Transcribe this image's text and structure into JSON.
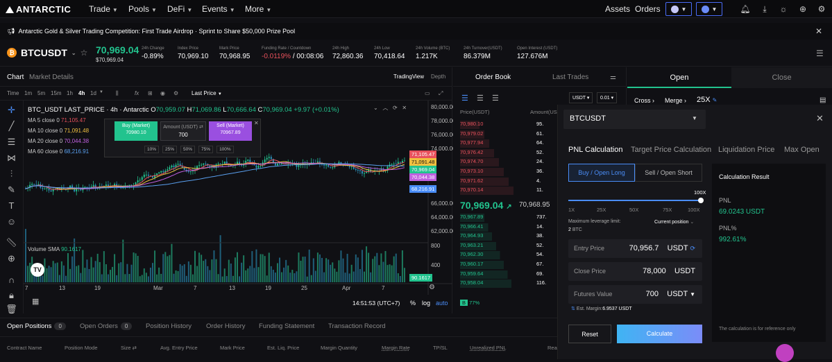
{
  "nav": {
    "logo": "ANTARCTIC",
    "items": [
      "Trade",
      "Pools",
      "DeFi",
      "Events",
      "More"
    ],
    "assets": "Assets",
    "orders": "Orders"
  },
  "banner": {
    "text": "Antarctic Gold & Silver Trading Competition: First Trade Airdrop · Sprint to Share $50,000 Prize Pool"
  },
  "ticker": {
    "symbol": "BTCUSDT",
    "price": "70,969.04",
    "sub_price": "$70,969.04",
    "stats": [
      {
        "label": "24h Change",
        "value": "-0.89%",
        "color": "red"
      },
      {
        "label": "Index Price",
        "value": "70,969.10",
        "color": "white"
      },
      {
        "label": "Mark Price",
        "value": "70,968.95",
        "color": "white"
      },
      {
        "label": "Funding Rate / Countdown",
        "value": "-0.0119%",
        "value2": "/ 00:08:06",
        "color": "red"
      },
      {
        "label": "24h High",
        "value": "72,860.36",
        "color": "white"
      },
      {
        "label": "24h Low",
        "value": "70,418.64",
        "color": "white"
      },
      {
        "label": "24h Volume (BTC)",
        "value": "1.217K",
        "color": "white"
      },
      {
        "label": "24h Turnover(USDT)",
        "value": "86.379M",
        "color": "white"
      },
      {
        "label": "Open Interest (USDT)",
        "value": "127.676M",
        "color": "white"
      }
    ]
  },
  "chart": {
    "tab_chart": "Chart",
    "tab_market": "Market Details",
    "tab_tv": "TradingView",
    "tab_depth": "Depth",
    "intervals": [
      "Time",
      "1m",
      "5m",
      "15m",
      "1h",
      "4h",
      "1d"
    ],
    "last_price": "Last Price",
    "title": "BTC_USDT LAST_PRICE · 4h · Antarctic",
    "ohlc": {
      "o": "70,959.07",
      "h": "71,069.86",
      "l": "70,666.64",
      "c": "70,969.04",
      "chg": "+9.97 (+0.01%)"
    },
    "ma": [
      {
        "label": "MA 5 close 0",
        "value": "71,105.47",
        "color": "#e8515c"
      },
      {
        "label": "MA 10 close 0",
        "value": "71,091.48",
        "color": "#f0c040"
      },
      {
        "label": "MA 20 close 0",
        "value": "70,044.38",
        "color": "#c060e0"
      },
      {
        "label": "MA 60 close 0",
        "value": "68,216.91",
        "color": "#5aa0f0"
      }
    ],
    "volume": {
      "label": "Volume",
      "sma": "SMA",
      "value": "90.1617"
    },
    "yaxis": [
      "80,000.00",
      "78,000.00",
      "76,000.00",
      "74,000.00",
      "66,000.00",
      "64,000.00",
      "62,000.00"
    ],
    "vol_axis": [
      "800",
      "400"
    ],
    "price_tags": [
      {
        "v": "71,105.47",
        "c": "#e8515c"
      },
      {
        "v": "71,091.48",
        "c": "#f0c040"
      },
      {
        "v": "70,969.04",
        "c": "#22c38e"
      },
      {
        "v": "70,044.38",
        "c": "#c060e0"
      },
      {
        "v": "68,216.91",
        "c": "#4a8df8"
      },
      {
        "v": "90.1617",
        "c": "#22c38e"
      }
    ],
    "xaxis": [
      "7",
      "13",
      "19",
      "Mar",
      "7",
      "13",
      "19",
      "25",
      "Apr",
      "7"
    ],
    "time": "14:51:53 (UTC+7)",
    "pct": "%",
    "log": "log",
    "auto": "auto",
    "quick": {
      "buy": "Buy (Market)",
      "buy_price": "70980.10",
      "amount_label": "Amount (USDT)",
      "amount": "700",
      "sell": "Sell (Market)",
      "sell_price": "70967.89",
      "pcts": [
        "10%",
        "25%",
        "50%",
        "75%",
        "100%"
      ]
    }
  },
  "orderbook": {
    "tab_ob": "Order Book",
    "tab_lt": "Last Trades",
    "unit": "USDT",
    "step": "0.01",
    "col_price": "Price(USDT)",
    "col_amount": "Amount(USDT)",
    "asks": [
      [
        "70,980.10",
        "95."
      ],
      [
        "70,979.02",
        "61."
      ],
      [
        "70,977.94",
        "64."
      ],
      [
        "70,976.42",
        "52."
      ],
      [
        "70,974.70",
        "24."
      ],
      [
        "70,973.10",
        "36."
      ],
      [
        "70,971.62",
        "4."
      ],
      [
        "70,970.14",
        "11."
      ]
    ],
    "mid": "70,969.04",
    "mid_mark": "70,968.95",
    "bids": [
      [
        "70,967.89",
        "737."
      ],
      [
        "70,966.41",
        "14."
      ],
      [
        "70,964.93",
        "38."
      ],
      [
        "70,963.21",
        "52."
      ],
      [
        "70,962.30",
        "54."
      ],
      [
        "70,960.17",
        "67."
      ],
      [
        "70,959.64",
        "69."
      ],
      [
        "70,958.04",
        "116."
      ]
    ],
    "ratio": "77%"
  },
  "trade": {
    "open": "Open",
    "close": "Close",
    "cross": "Cross",
    "merge": "Merge",
    "leverage": "25X"
  },
  "calc": {
    "symbol": "BTCUSDT",
    "tabs": [
      "PNL Calculation",
      "Target Price Calculation",
      "Liquidation Price",
      "Max Open"
    ],
    "buy": "Buy / Open Long",
    "sell": "Sell / Open Short",
    "lev_max": "100X",
    "lev_marks": [
      "1X",
      "25X",
      "50X",
      "75X",
      "100X"
    ],
    "max_lev_label": "Maximum leverage limit:",
    "max_lev_value": "2",
    "max_lev_unit": "BTC",
    "current_position": "Current position",
    "entry_label": "Entry Price",
    "entry_value": "70,956.7",
    "entry_unit": "USDT",
    "close_label": "Close Price",
    "close_value": "78,000",
    "close_unit": "USDT",
    "futures_label": "Futures Value",
    "futures_value": "700",
    "futures_unit": "USDT",
    "margin_label": "Est. Margin:",
    "margin_value": "6.9537 USDT",
    "reset": "Reset",
    "calculate": "Calculate",
    "result_title": "Calculation Result",
    "pnl_label": "PNL",
    "pnl_value": "69.0243 USDT",
    "pnlp_label": "PNL%",
    "pnlp_value": "992.61%",
    "note": "The calculation is for reference only"
  },
  "bottom": {
    "tabs": [
      {
        "label": "Open Positions",
        "count": "0"
      },
      {
        "label": "Open Orders",
        "count": "0"
      },
      {
        "label": "Position History"
      },
      {
        "label": "Order History"
      },
      {
        "label": "Funding Statement"
      },
      {
        "label": "Transaction Record"
      }
    ],
    "cols": [
      "Contract Name",
      "Position Mode",
      "Size ⇄",
      "Avg. Entry Price",
      "Mark Price",
      "Est. Liq. Price",
      "Margin Quantity",
      "Margin Rate",
      "TP/SL",
      "Unrealized PNL",
      "Rea"
    ]
  }
}
